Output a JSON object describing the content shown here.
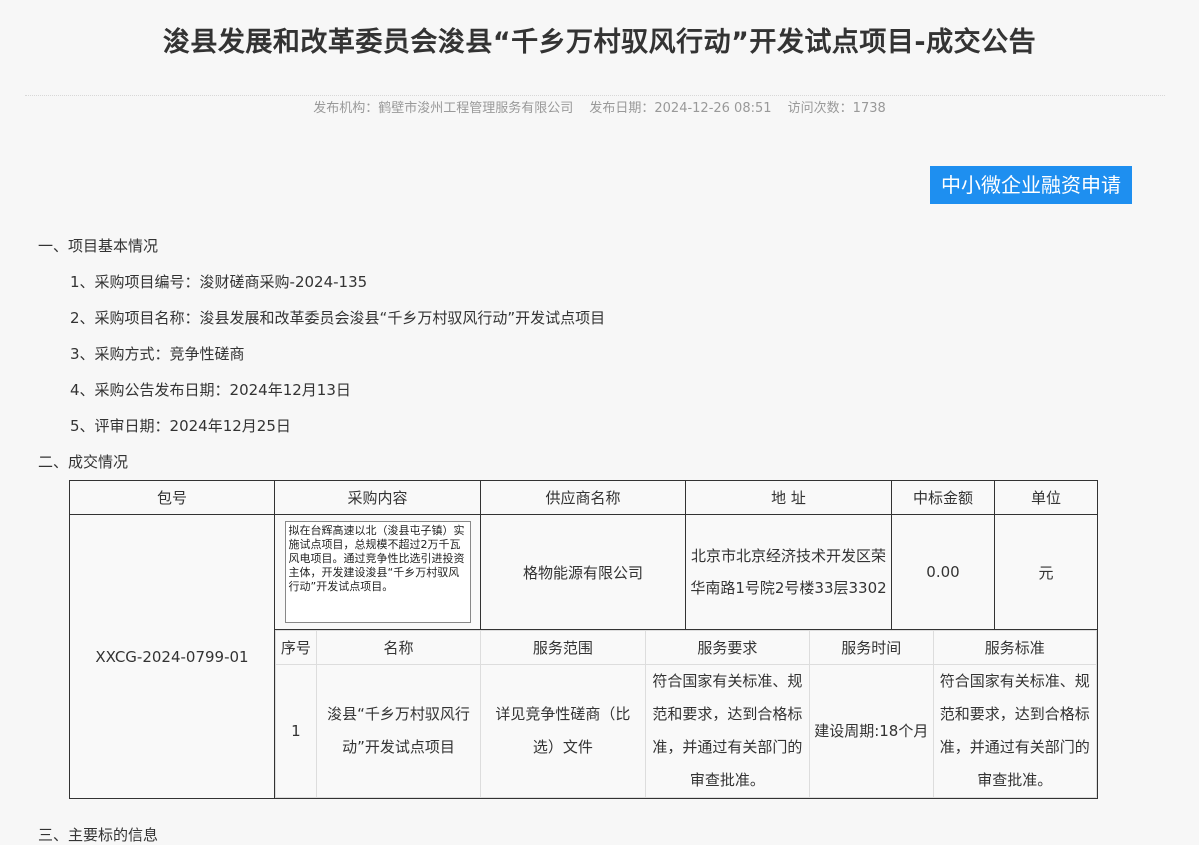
{
  "page": {
    "title": "浚县发展和改革委员会浚县“千乡万村驭风行动”开发试点项目-成交公告",
    "meta": {
      "publisher": "发布机构：鹤壁市浚州工程管理服务有限公司",
      "date": "发布日期：2024-12-26 08:51",
      "visits": "访问次数：1738"
    },
    "apply_button": "中小微企业融资申请"
  },
  "sections": {
    "s1": "一、项目基本情况",
    "items": [
      "1、采购项目编号：浚财磋商采购-2024-135",
      "2、采购项目名称：浚县发展和改革委员会浚县“千乡万村驭风行动”开发试点项目",
      "3、采购方式：竞争性磋商",
      "4、采购公告发布日期：2024年12月13日",
      "5、评审日期：2024年12月25日"
    ],
    "s2": "二、成交情况"
  },
  "deal_table": {
    "headers": [
      "包号",
      "采购内容",
      "供应商名称",
      "地 址",
      "中标金额",
      "单位"
    ],
    "package_no": "XXCG-2024-0799-01",
    "content": "拟在台辉高速以北（浚县屯子镇）实施试点项目，总规模不超过2万千瓦风电项目。通过竞争性比选引进投资主体，开发建设浚县“千乡万村驭风行动”开发试点项目。",
    "supplier": "格物能源有限公司",
    "address": "北京市北京经济技术开发区荣华南路1号院2号楼33层3302",
    "amount": "0.00",
    "unit": "元"
  },
  "service_table": {
    "headers": [
      "序号",
      "名称",
      "服务范围",
      "服务要求",
      "服务时间",
      "服务标准"
    ],
    "row": {
      "no": "1",
      "name": "浚县“千乡万村驭风行动”开发试点项目",
      "scope": "详见竞争性磋商（比选）文件",
      "requirement": "符合国家有关标准、规范和要求，达到合格标准，并通过有关部门的审查批准。",
      "time": "建设周期:18个月",
      "standard": "符合国家有关标准、规范和要求，达到合格标准，并通过有关部门的审查批准。"
    }
  },
  "bottom": "三、主要标的信息"
}
